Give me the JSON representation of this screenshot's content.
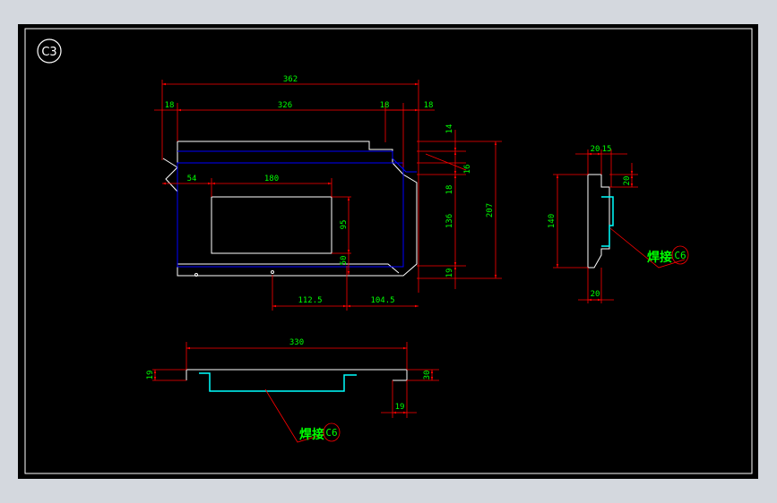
{
  "sheet": {
    "tag": "C3",
    "colors": {
      "background": "#000000",
      "frame": "#ffffff",
      "outline": "#ffffff",
      "hidden": "#0000ff",
      "dimension": "#ff0000",
      "text": "#00ff00",
      "weld": "#00ffff"
    }
  },
  "plan_view": {
    "dims": {
      "overall": "362",
      "inner": "326",
      "left_flange": "18",
      "right_flange_a": "18",
      "right_flange_b": "18",
      "opening_offset": "54",
      "opening_width": "180",
      "opening_height": "95",
      "opening_bottom": "50",
      "hole_left": "112.5",
      "hole_right": "104.5",
      "right_top": "14",
      "right_chamfer": "16",
      "right_flange_v": "18",
      "right_inner": "136",
      "right_bottom": "19",
      "right_overall": "207"
    }
  },
  "side_view": {
    "dims": {
      "top_a": "20",
      "top_b": "15",
      "lip": "20",
      "height": "140",
      "bottom": "20"
    },
    "weld_note": "焊接",
    "weld_size": "C6"
  },
  "bottom_view": {
    "dims": {
      "length": "330",
      "left_h": "19",
      "right_h": "30",
      "right_w": "19"
    },
    "weld_note": "焊接",
    "weld_size": "C6"
  }
}
